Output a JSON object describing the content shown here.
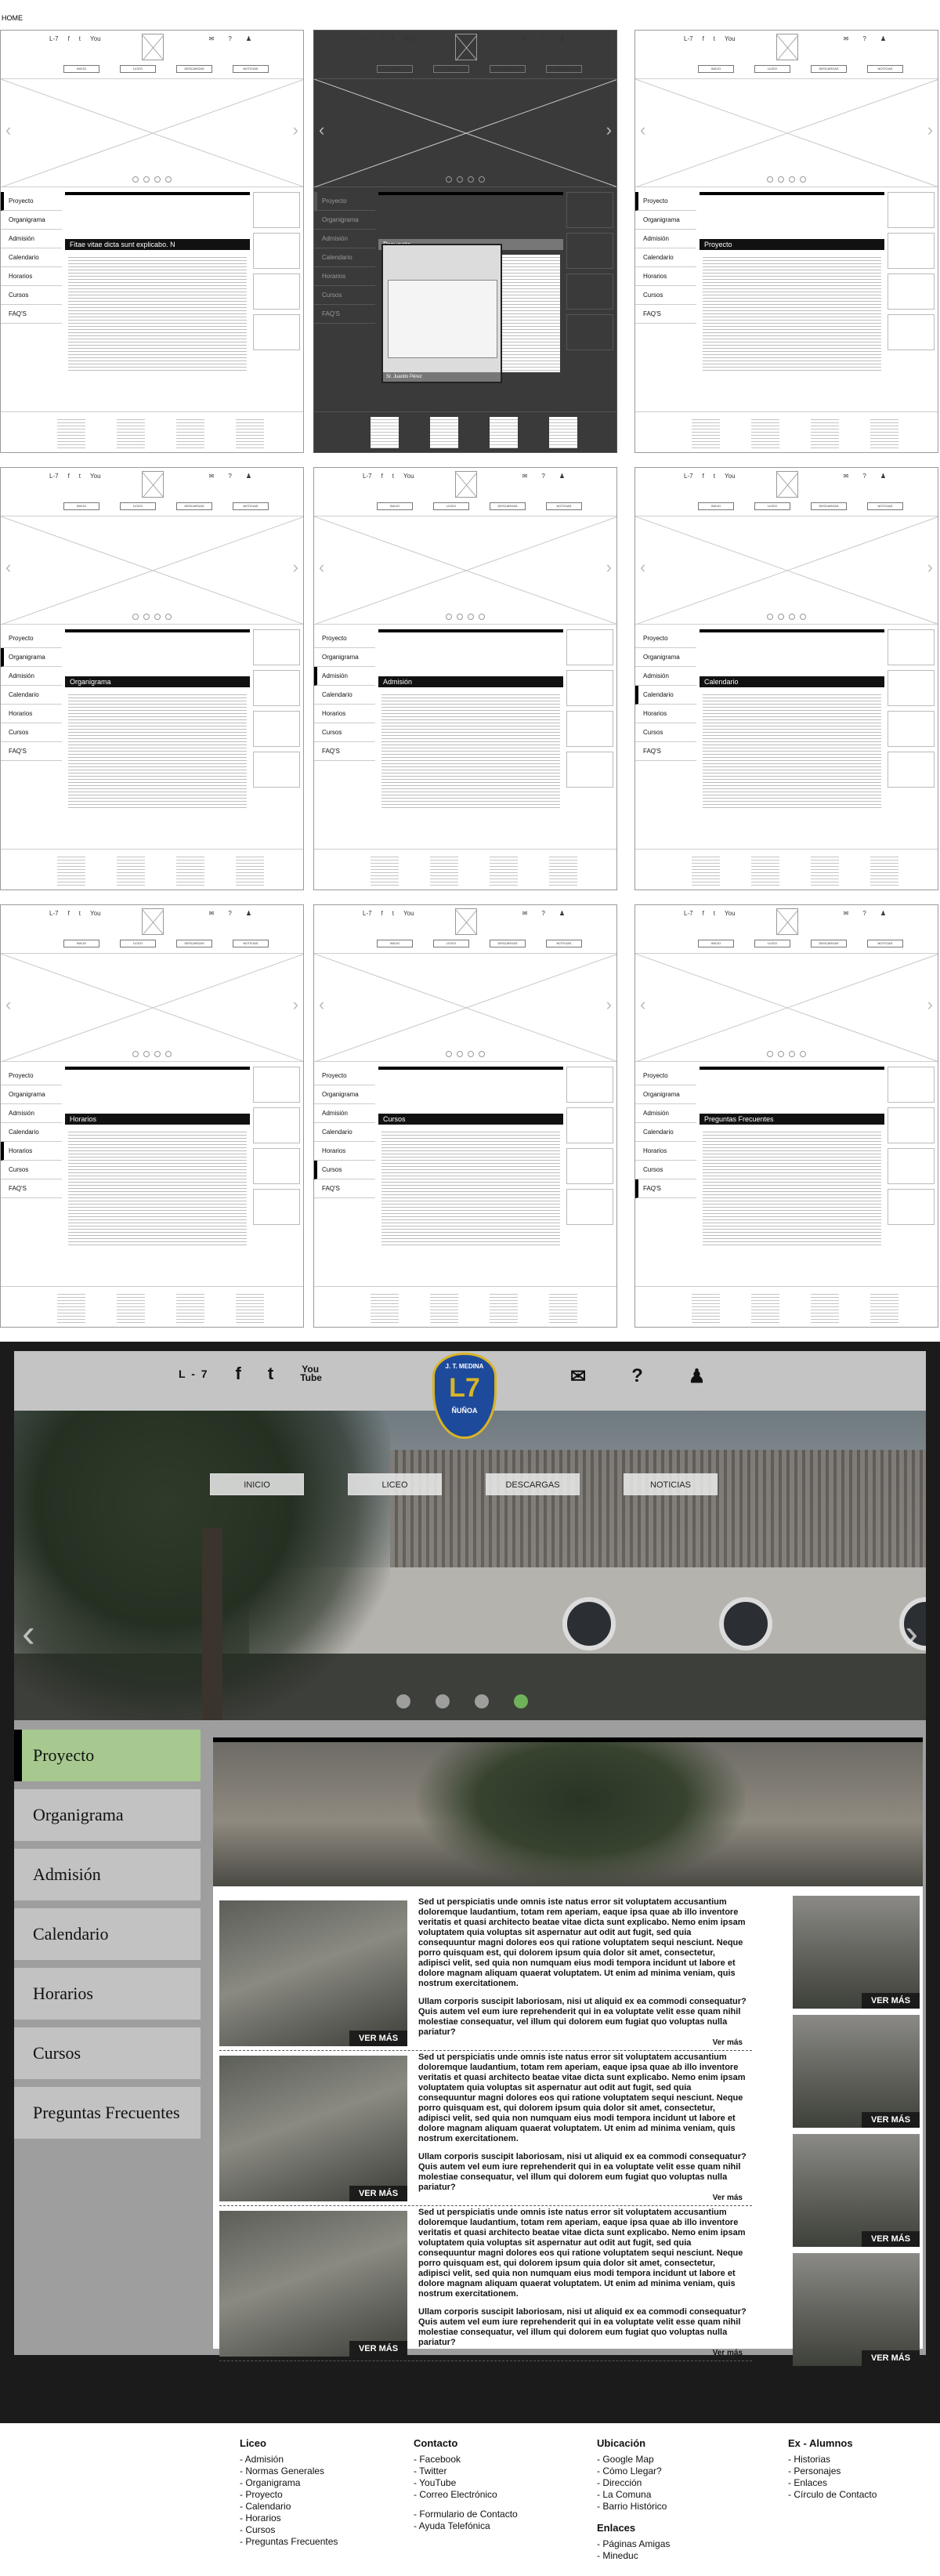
{
  "corner_label": "HOME",
  "wireframe": {
    "social": [
      "L-7",
      "f",
      "t",
      "You"
    ],
    "util": [
      "✉",
      "?",
      "♟"
    ],
    "nav": [
      "INICIO",
      "LICEO",
      "DESCARGAS",
      "NOTICIAS"
    ],
    "sidebar": [
      "Proyecto",
      "Organigrama",
      "Admisión",
      "Calendario",
      "Horarios",
      "Cursos",
      "FAQ'S"
    ],
    "frames": [
      {
        "title": "Fitae vitae dicta sunt explicabo. N",
        "active": 0
      },
      {
        "title": "Proyecto",
        "active": 0,
        "dark": true,
        "modal_caption": "Sr. Juanito Pérez"
      },
      {
        "title": "Proyecto",
        "active": 0
      },
      {
        "title": "Organigrama",
        "active": 1
      },
      {
        "title": "Admisión",
        "active": 2
      },
      {
        "title": "Calendario",
        "active": 3
      },
      {
        "title": "Horarios",
        "active": 4
      },
      {
        "title": "Cursos",
        "active": 5
      },
      {
        "title": "Preguntas Frecuentes",
        "active": 6
      }
    ]
  },
  "hifi": {
    "social": {
      "l7": "L - 7",
      "facebook": "f",
      "twitter": "t",
      "youtube": "You Tube"
    },
    "util": {
      "mail": "✉",
      "help": "?",
      "user": "♟"
    },
    "logo": {
      "name": "J. T. MEDINA",
      "mark": "L7",
      "city": "ÑUÑOA"
    },
    "nav": [
      "INICIO",
      "LICEO",
      "DESCARGAS",
      "NOTICIAS"
    ],
    "sidebar": [
      "Proyecto",
      "Organigrama",
      "Admisión",
      "Calendario",
      "Horarios",
      "Cursos",
      "Preguntas Frecuentes"
    ],
    "active_index": 0,
    "paragraph_a": "Sed ut perspiciatis unde omnis iste natus error sit voluptatem accusantium doloremque laudantium, totam rem aperiam, eaque ipsa quae ab illo inventore veritatis et quasi architecto beatae vitae dicta sunt explicabo. Nemo enim ipsam voluptatem quia voluptas sit aspernatur aut odit aut fugit, sed quia consequuntur magni dolores eos qui ratione voluptatem sequi nesciunt. Neque porro quisquam est, qui dolorem ipsum quia dolor sit amet, consectetur, adipisci velit, sed quia non numquam eius modi tempora incidunt ut labore et dolore magnam aliquam quaerat voluptatem. Ut enim ad minima veniam, quis nostrum exercitationem.",
    "paragraph_b": "Ullam corporis suscipit laboriosam, nisi ut aliquid ex ea commodi consequatur? Quis autem vel eum iure reprehenderit qui in ea voluptate velit esse quam nihil molestiae consequatur, vel illum qui dolorem eum fugiat quo voluptas nulla pariatur?",
    "ver_mas_thumb": "VER MÁS",
    "ver_mas_link": "Ver más",
    "footer": {
      "liceo": {
        "title": "Liceo",
        "items": [
          "- Admisión",
          "- Normas Generales",
          "- Organigrama",
          "- Proyecto",
          "- Calendario",
          "- Horarios",
          "- Cursos",
          "- Preguntas Frecuentes"
        ]
      },
      "contacto": {
        "title": "Contacto",
        "items": [
          "- Facebook",
          "- Twitter",
          "- YouTube",
          "- Correo Electrónico"
        ],
        "items2": [
          "- Formulario de Contacto",
          "- Ayuda Telefónica"
        ]
      },
      "ubicacion": {
        "title": "Ubicación",
        "items": [
          "- Google Map",
          "- Cómo Llegar?",
          "- Dirección",
          "- La Comuna",
          "- Barrio Histórico"
        ]
      },
      "enlaces": {
        "title": "Enlaces",
        "items": [
          "- Páginas Amigas",
          "- Mineduc"
        ]
      },
      "exalumnos": {
        "title": "Ex - Alumnos",
        "items": [
          "- Historias",
          "- Personajes",
          "- Enlaces",
          "- Círculo de Contacto"
        ]
      }
    }
  }
}
